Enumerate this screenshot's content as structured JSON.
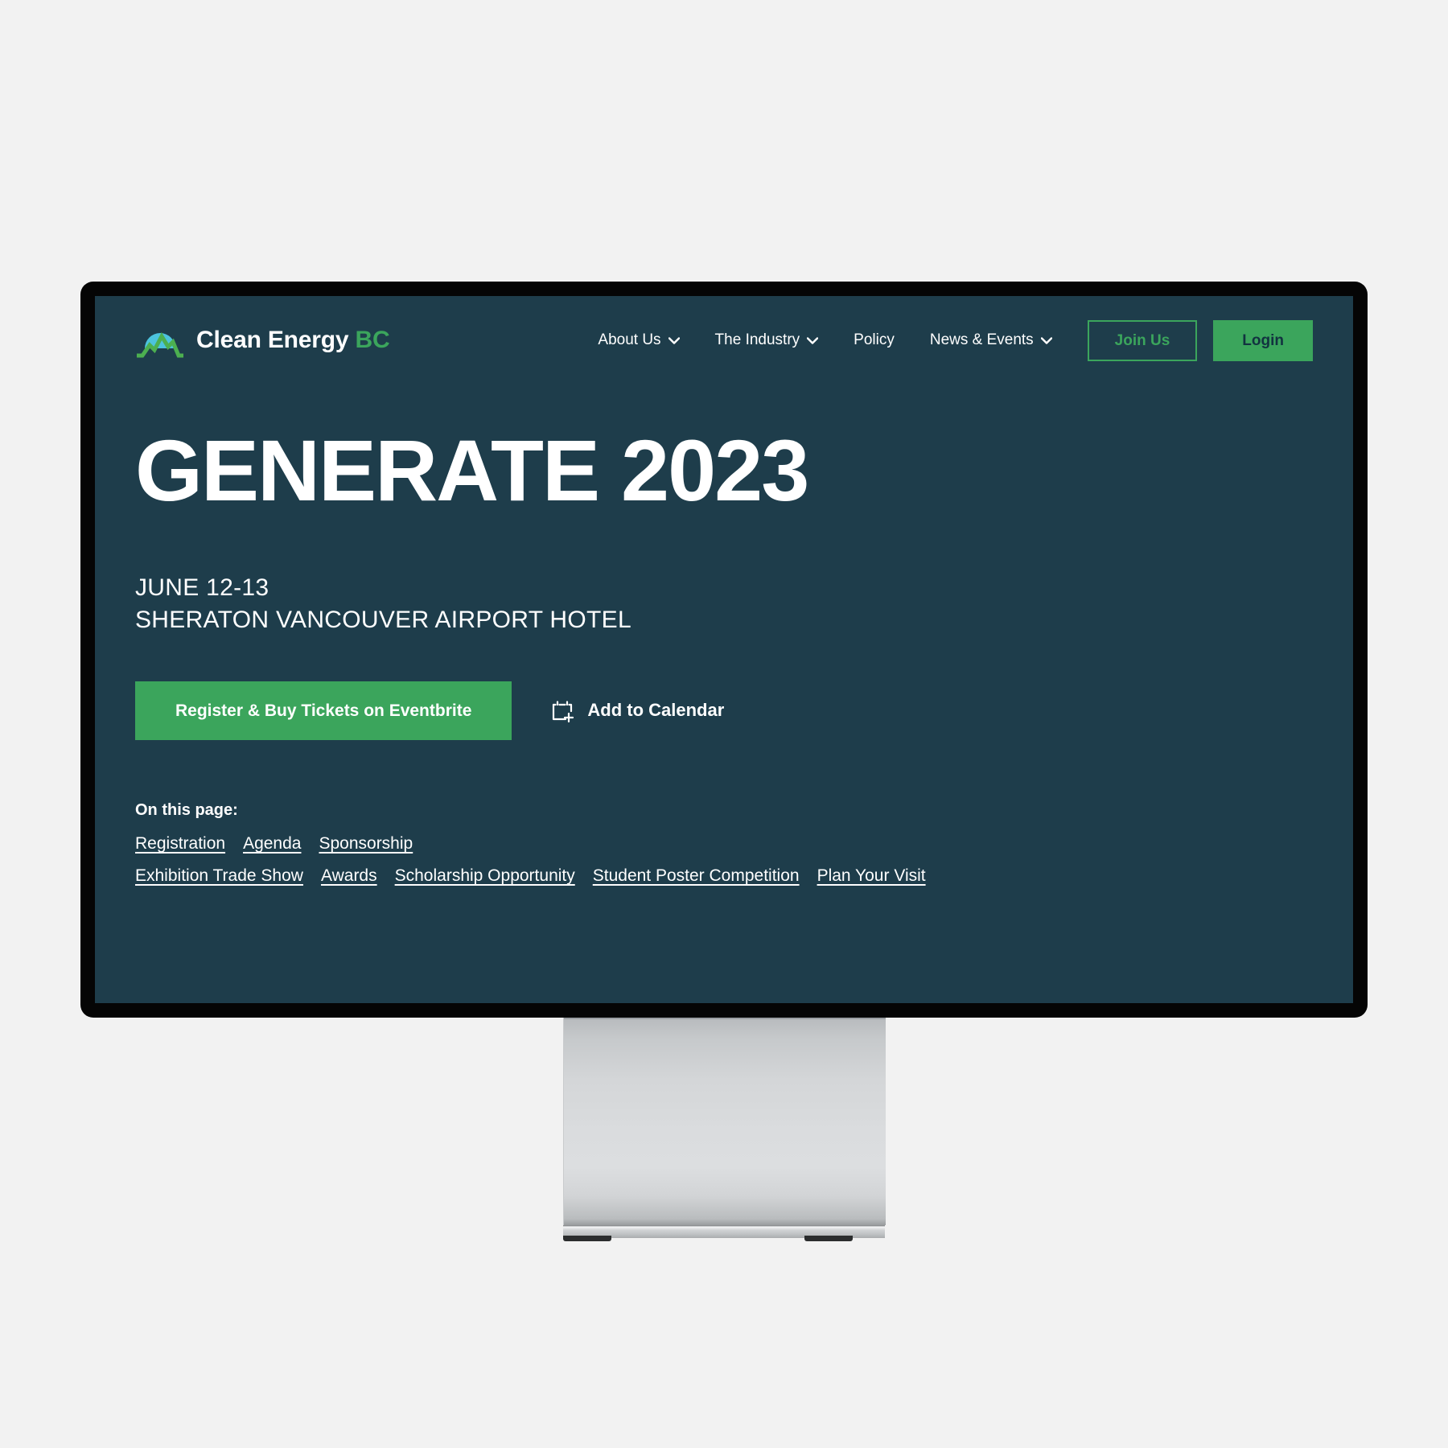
{
  "brand": {
    "name_main": "Clean Energy",
    "name_suffix": "BC",
    "logo_icon": "mountain-sun-logo-icon",
    "colors": {
      "dome": "#4cc3dd",
      "mountain": "#4caf50",
      "accent": "#3ba55c"
    }
  },
  "nav": {
    "items": [
      {
        "label": "About Us",
        "has_dropdown": true,
        "icon": "chevron-down-icon"
      },
      {
        "label": "The Industry",
        "has_dropdown": true,
        "icon": "chevron-down-icon"
      },
      {
        "label": "Policy",
        "has_dropdown": false
      },
      {
        "label": "News & Events",
        "has_dropdown": true,
        "icon": "chevron-down-icon"
      }
    ],
    "join_label": "Join Us",
    "login_label": "Login"
  },
  "hero": {
    "title": "GENERATE 2023",
    "date": "JUNE 12-13",
    "venue": "SHERATON VANCOUVER AIRPORT HOTEL",
    "register_label": "Register & Buy Tickets on Eventbrite",
    "add_calendar_label": "Add to Calendar",
    "add_calendar_icon": "calendar-plus-icon"
  },
  "on_this_page": {
    "title": "On this page:",
    "row1": [
      "Registration",
      "Agenda",
      "Sponsorship"
    ],
    "row2": [
      "Exhibition Trade Show",
      "Awards",
      "Scholarship Opportunity",
      "Student Poster Competition",
      "Plan Your Visit"
    ]
  },
  "theme": {
    "page_background": "#f2f2f2",
    "screen_background": "#1e3d4b",
    "bezel": "#050505",
    "accent_green": "#3ba55c",
    "text_white": "#ffffff"
  }
}
